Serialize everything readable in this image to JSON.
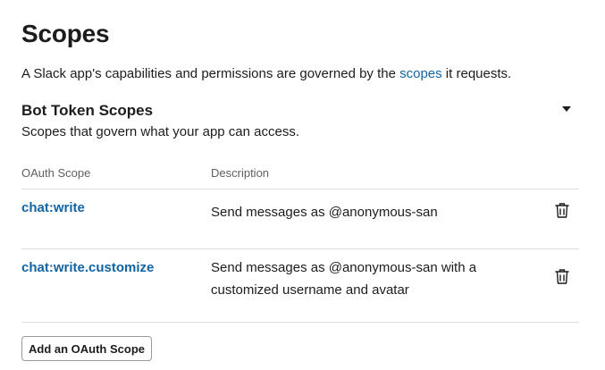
{
  "page": {
    "title": "Scopes",
    "intro_before": "A Slack app's capabilities and permissions are governed by the ",
    "intro_link": "scopes",
    "intro_after": " it requests."
  },
  "section": {
    "title": "Bot Token Scopes",
    "subtitle": "Scopes that govern what your app can access."
  },
  "table": {
    "headers": [
      "OAuth Scope",
      "Description"
    ],
    "rows": [
      {
        "scope": "chat:write",
        "description": "Send messages as @anonymous-san"
      },
      {
        "scope": "chat:write.customize",
        "description": "Send messages as @anonymous-san with a customized username and avatar"
      }
    ]
  },
  "actions": {
    "add_scope_label": "Add an OAuth Scope"
  },
  "icons": {
    "collapse": "caret-down-icon",
    "delete": "trash-icon"
  },
  "colors": {
    "link": "#1264a3",
    "text": "#1d1c1d",
    "muted": "#616061",
    "divider": "#dddddd"
  }
}
